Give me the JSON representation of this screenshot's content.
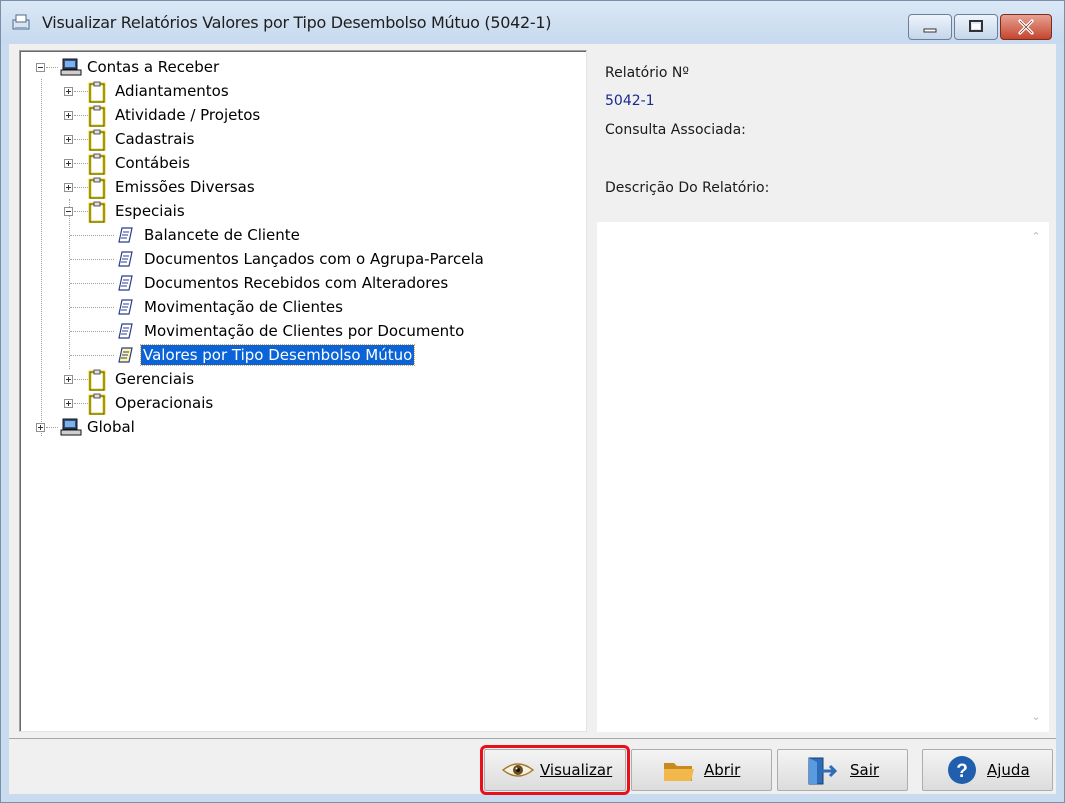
{
  "window": {
    "title": "Visualizar Relatórios Valores por Tipo Desembolso Mútuo (5042-1)"
  },
  "tree": {
    "root": "Contas a Receber",
    "folders_top": [
      "Adiantamentos",
      "Atividade / Projetos",
      "Cadastrais",
      "Contábeis",
      "Emissões Diversas",
      "Especiais"
    ],
    "reports": [
      "Balancete de Cliente",
      "Documentos Lançados com o Agrupa-Parcela",
      "Documentos Recebidos com Alteradores",
      "Movimentação de Clientes",
      "Movimentação de Clientes por Documento",
      "Valores por Tipo Desembolso Mútuo"
    ],
    "folders_bottom": [
      "Gerenciais",
      "Operacionais"
    ],
    "root2": "Global"
  },
  "details": {
    "report_no_label": "Relatório Nº",
    "report_no_value": "5042-1",
    "consulta_label": "Consulta Associada:",
    "descricao_label": "Descrição Do Relatório:"
  },
  "buttons": {
    "visualizar": "Visualizar",
    "abrir": "Abrir",
    "sair": "Sair",
    "ajuda": "Ajuda"
  },
  "colors": {
    "selection": "#0a64d8",
    "highlight_box": "#e8101a",
    "value_text": "#1a2a8e"
  }
}
